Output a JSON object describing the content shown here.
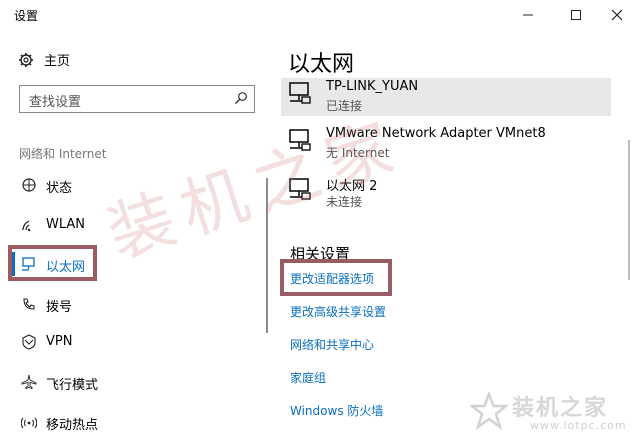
{
  "window": {
    "title": "设置",
    "controls": [
      "minimize",
      "maximize",
      "close"
    ]
  },
  "sidebar": {
    "home_label": "主页",
    "search_placeholder": "查找设置",
    "section_label": "网络和 Internet",
    "items": [
      {
        "label": "状态",
        "icon": "status-icon"
      },
      {
        "label": "WLAN",
        "icon": "wifi-icon"
      },
      {
        "label": "以太网",
        "icon": "ethernet-icon",
        "selected": true
      },
      {
        "label": "拨号",
        "icon": "dialup-icon"
      },
      {
        "label": "VPN",
        "icon": "vpn-icon"
      },
      {
        "label": "飞行模式",
        "icon": "airplane-icon"
      },
      {
        "label": "移动热点",
        "icon": "hotspot-icon"
      }
    ]
  },
  "main": {
    "title": "以太网",
    "adapters": [
      {
        "name": "TP-LINK_YUAN",
        "status": "已连接",
        "highlighted": true
      },
      {
        "name": "VMware Network Adapter VMnet8",
        "status": "无 Internet"
      },
      {
        "name": "以太网 2",
        "status": "未连接"
      }
    ],
    "related_title": "相关设置",
    "related_links": [
      "更改适配器选项",
      "更改高级共享设置",
      "网络和共享中心",
      "家庭组",
      "Windows 防火墙"
    ]
  },
  "watermark": {
    "text": "装机之家",
    "logo_text": "装机之家",
    "logo_url": "www.lotpc.com"
  },
  "colors": {
    "accent": "#0a6fc2",
    "highlight_box": "#9a5b62",
    "selected_row": "#e8e8e8"
  }
}
